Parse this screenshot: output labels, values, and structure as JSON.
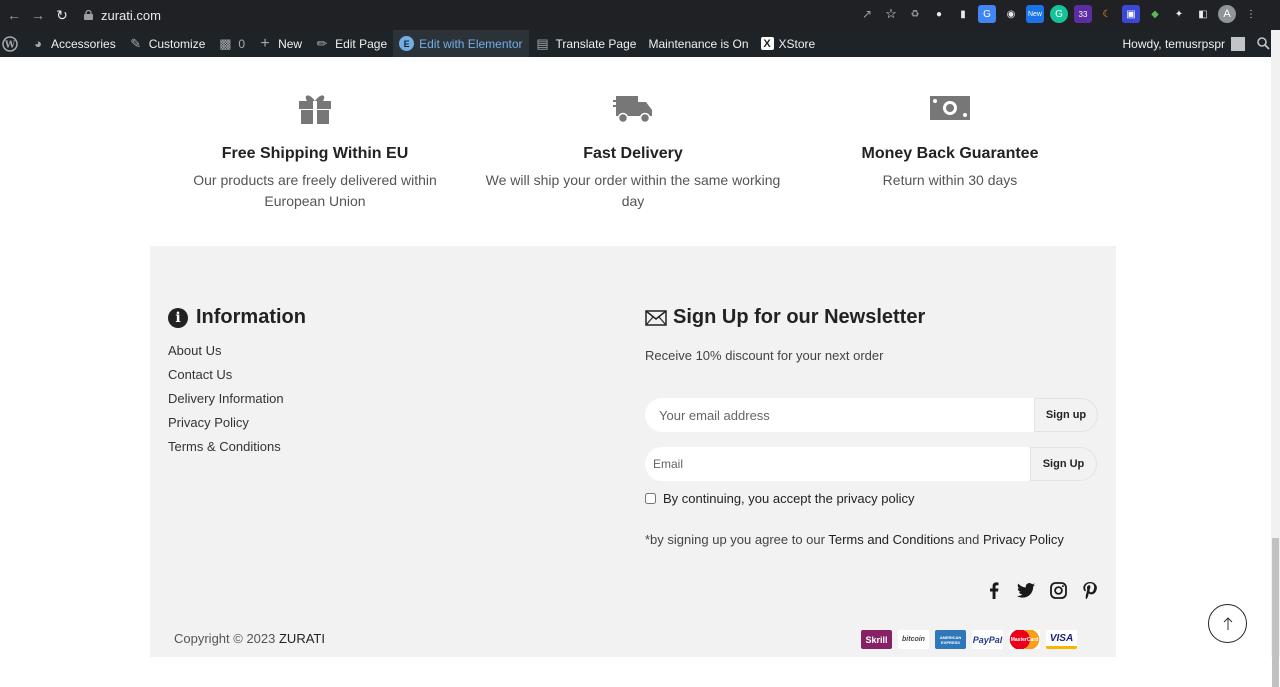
{
  "browser": {
    "url": "zurati.com",
    "ext_badge_new": "New",
    "ext_badge_count": "33",
    "profile_initial": "A"
  },
  "wpbar": {
    "items": [
      {
        "label": "Accessories"
      },
      {
        "label": "Customize"
      },
      {
        "label": "0"
      },
      {
        "label": "New"
      },
      {
        "label": "Edit Page"
      },
      {
        "label": "Edit with Elementor"
      },
      {
        "label": "Translate Page"
      },
      {
        "label": "Maintenance is On"
      },
      {
        "label": "XStore"
      }
    ],
    "howdy": "Howdy, temusrpspr"
  },
  "features": [
    {
      "title": "Free Shipping Within EU",
      "text": "Our products are freely delivered within European Union",
      "icon": "gift-icon"
    },
    {
      "title": "Fast Delivery",
      "text": "We will ship your order within the same working day",
      "icon": "truck-icon"
    },
    {
      "title": "Money Back Guarantee",
      "text": "Return within 30 days",
      "icon": "cash-icon"
    }
  ],
  "info": {
    "title": "Information",
    "links": [
      "About Us",
      "Contact Us",
      "Delivery Information",
      "Privacy Policy",
      "Terms & Conditions"
    ]
  },
  "newsletter": {
    "title": "Sign Up for our Newsletter",
    "subtitle": "Receive 10% discount for your next order",
    "input1_placeholder": "Your email address",
    "button1": "Sign up",
    "input2_placeholder": "Email",
    "button2": "Sign Up",
    "consent": "By continuing, you accept the privacy policy",
    "note_prefix": "*by signing up you agree to our ",
    "note_terms": "Terms and Conditions",
    "note_and": " and ",
    "note_privacy": "Privacy Policy"
  },
  "copyright": {
    "prefix": "Copyright © 2023 ",
    "brand": "ZURATI"
  },
  "payments": [
    "Skrill",
    "bitcoin",
    "AMERICAN EXPRESS",
    "PayPal",
    "MasterCard",
    "VISA"
  ],
  "colors": {
    "chrome_bg": "#202124",
    "wpbar_bg": "#1d2327",
    "footer_bg": "#f2f2f2",
    "elementor_blue": "#72aee6"
  }
}
